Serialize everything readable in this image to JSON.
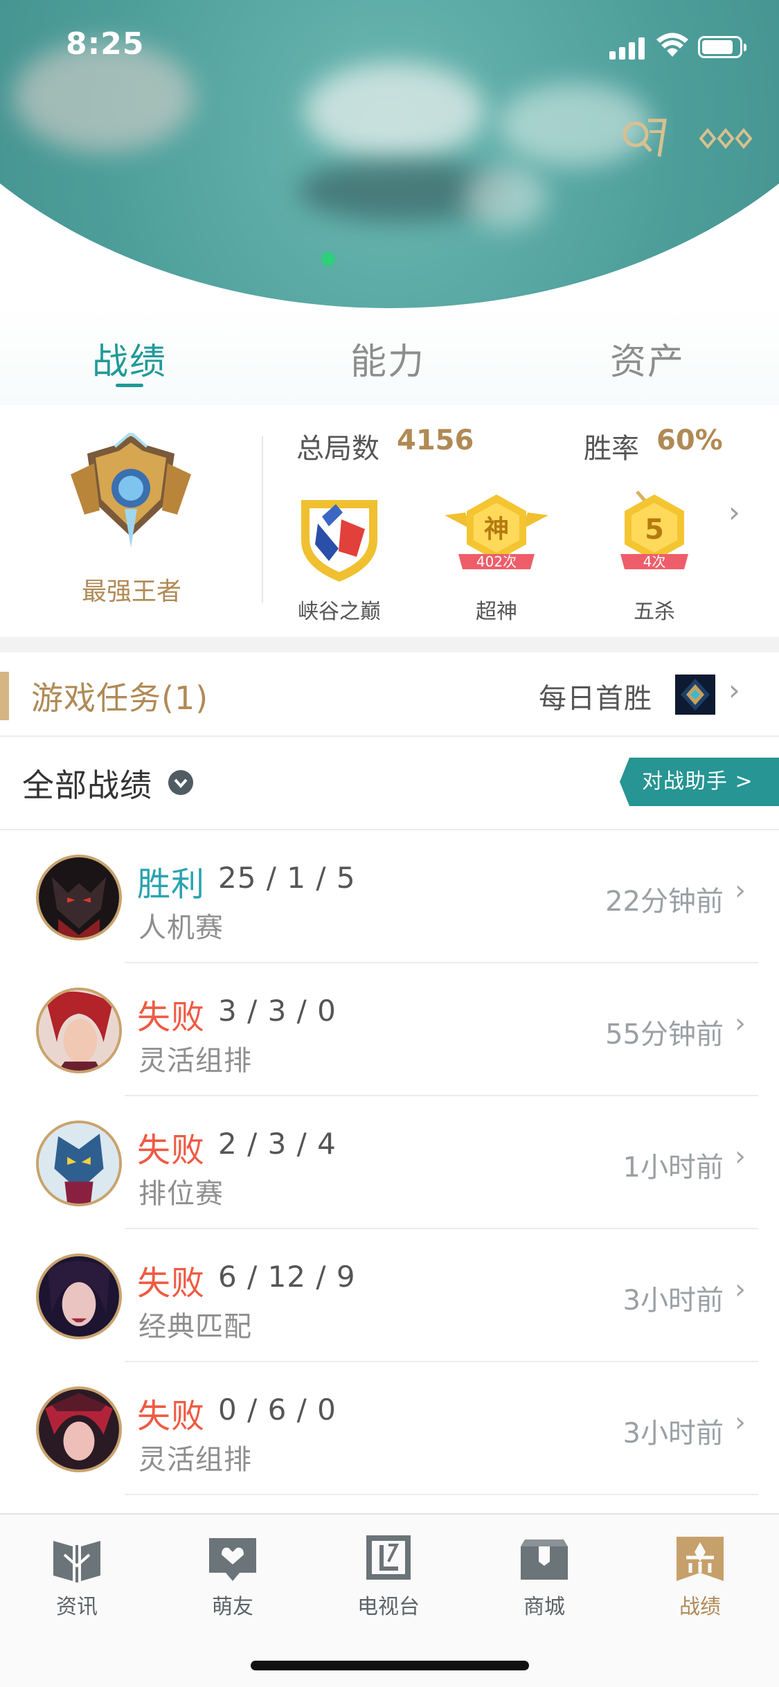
{
  "status_bar": {
    "time": "8:25"
  },
  "header": {
    "icons": [
      "qr-code-icon",
      "more-dots-icon"
    ]
  },
  "top_tabs": [
    {
      "label": "战绩",
      "active": true
    },
    {
      "label": "能力",
      "active": false
    },
    {
      "label": "资产",
      "active": false
    }
  ],
  "summary": {
    "rank_name": "最强王者",
    "total_games_label": "总局数",
    "total_games_value": "4156",
    "win_rate_label": "胜率",
    "win_rate_value": "60%",
    "badges": [
      {
        "label": "峡谷之巅",
        "icon": "peak-shield-icon"
      },
      {
        "label": "超神",
        "icon": "godlike-badge-icon",
        "glyph": "神",
        "count": "402次"
      },
      {
        "label": "五杀",
        "icon": "pentakill-badge-icon",
        "glyph": "5",
        "count": "4次"
      }
    ]
  },
  "task": {
    "title": "游戏任务(1)",
    "right_label": "每日首胜"
  },
  "records": {
    "title": "全部战绩",
    "assist_button": "对战助手 >"
  },
  "matches": [
    {
      "result": "胜利",
      "kda": "25 / 1 / 5",
      "mode": "人机赛",
      "time": "22分钟前",
      "win": true
    },
    {
      "result": "失败",
      "kda": "3 / 3 / 0",
      "mode": "灵活组排",
      "time": "55分钟前",
      "win": false
    },
    {
      "result": "失败",
      "kda": "2 / 3 / 4",
      "mode": "排位赛",
      "time": "1小时前",
      "win": false
    },
    {
      "result": "失败",
      "kda": "6 / 12 / 9",
      "mode": "经典匹配",
      "time": "3小时前",
      "win": false
    },
    {
      "result": "失败",
      "kda": "0 / 6 / 0",
      "mode": "灵活组排",
      "time": "3小时前",
      "win": false
    }
  ],
  "bottom_nav": [
    {
      "label": "资讯",
      "icon": "news-book-icon",
      "active": false
    },
    {
      "label": "萌友",
      "icon": "friends-heart-icon",
      "active": false
    },
    {
      "label": "电视台",
      "icon": "tv-icon",
      "active": false
    },
    {
      "label": "商城",
      "icon": "shop-box-icon",
      "active": false
    },
    {
      "label": "战绩",
      "icon": "record-shield-icon",
      "active": true
    }
  ],
  "colors": {
    "accent_teal": "#1f9a96",
    "gold": "#b08a55",
    "win": "#2aa3b0",
    "loss": "#ef5a43"
  }
}
